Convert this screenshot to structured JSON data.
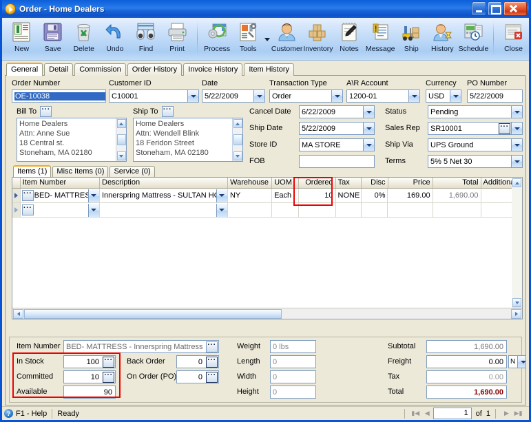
{
  "window": {
    "title": "Order - Home Dealers",
    "icon": "play-circle-icon",
    "buttons": {
      "minimize": "minimize-icon",
      "maximize": "maximize-icon",
      "close": "close-icon"
    }
  },
  "toolbar": {
    "items": [
      {
        "label": "New",
        "icon": "new-document-icon"
      },
      {
        "label": "Save",
        "icon": "floppy-disk-icon"
      },
      {
        "label": "Delete",
        "icon": "trash-can-icon"
      },
      {
        "label": "Undo",
        "icon": "undo-arrow-icon"
      },
      {
        "label": "Find",
        "icon": "binoculars-icon"
      },
      {
        "label": "Print",
        "icon": "printer-icon"
      },
      {
        "label": "Process",
        "icon": "gear-window-icon"
      },
      {
        "label": "Tools",
        "icon": "wrench-screwdriver-icon"
      },
      {
        "label": "Customer",
        "icon": "person-icon"
      },
      {
        "label": "Inventory",
        "icon": "boxes-icon"
      },
      {
        "label": "Notes",
        "icon": "notepad-pen-icon"
      },
      {
        "label": "Message",
        "icon": "message-document-icon"
      },
      {
        "label": "Ship",
        "icon": "forklift-icon"
      },
      {
        "label": "History",
        "icon": "person-hourglass-icon"
      },
      {
        "label": "Schedule",
        "icon": "calendar-clock-icon"
      },
      {
        "label": "Close",
        "icon": "close-window-icon"
      }
    ]
  },
  "tabs": [
    {
      "label": "General",
      "active": true
    },
    {
      "label": "Detail",
      "active": false
    },
    {
      "label": "Commission",
      "active": false
    },
    {
      "label": "Order History",
      "active": false
    },
    {
      "label": "Invoice History",
      "active": false
    },
    {
      "label": "Item History",
      "active": false
    }
  ],
  "header_fields": {
    "order_number": {
      "label": "Order Number",
      "value": "OE-10038",
      "selected": true
    },
    "customer_id": {
      "label": "Customer ID",
      "value": "C10001"
    },
    "date": {
      "label": "Date",
      "value": "5/22/2009"
    },
    "transaction_type": {
      "label": "Transaction Type",
      "value": "Order"
    },
    "ar_account": {
      "label": "A\\R Account",
      "value": "1200-01"
    },
    "currency": {
      "label": "Currency",
      "value": "USD"
    },
    "po_number": {
      "label": "PO Number",
      "value": "5/22/2009"
    }
  },
  "bill_to": {
    "label": "Bill To",
    "lines": [
      "Home Dealers",
      "Attn: Anne Sue",
      "18 Central st.",
      "Stoneham, MA 02180"
    ]
  },
  "ship_to": {
    "label": "Ship To",
    "lines": [
      "Home Dealers",
      "Attn: Wendell Blink",
      "18 Feridon Street",
      "Stoneham, MA 02180"
    ]
  },
  "mid_left_fields": [
    {
      "label": "Cancel  Date",
      "value": "6/22/2009",
      "type": "combo"
    },
    {
      "label": "Ship Date",
      "value": "5/22/2009",
      "type": "combo"
    },
    {
      "label": "Store ID",
      "value": "MA STORE",
      "type": "combo"
    },
    {
      "label": "FOB",
      "value": "",
      "type": "text"
    }
  ],
  "mid_right_fields": [
    {
      "label": "Status",
      "value": "Pending",
      "type": "combo"
    },
    {
      "label": "Sales Rep",
      "value": "SR10001",
      "type": "combo-ellipsis"
    },
    {
      "label": "Ship Via",
      "value": "UPS Ground",
      "type": "combo"
    },
    {
      "label": "Terms",
      "value": "5% 5 Net 30",
      "type": "combo"
    }
  ],
  "item_tabs": [
    {
      "label": "Items (1)",
      "active": true
    },
    {
      "label": "Misc Items (0)",
      "active": false
    },
    {
      "label": "Service (0)",
      "active": false
    }
  ],
  "grid": {
    "columns": [
      "Item Number",
      "Description",
      "Warehouse",
      "UOM",
      "Ordered",
      "Tax",
      "Disc",
      "Price",
      "Total",
      "Additional"
    ],
    "highlight_column": "Ordered",
    "rows": [
      {
        "item_number": "BED- MATTRESS",
        "description": "Innerspring Mattress - SULTAN HO",
        "warehouse": "NY",
        "uom": "Each",
        "ordered": "10",
        "tax": "NONE",
        "disc": "0%",
        "price": "169.00",
        "total": "1,690.00",
        "additional": ""
      },
      {
        "item_number": "",
        "description": "",
        "warehouse": "",
        "uom": "",
        "ordered": "",
        "tax": "",
        "disc": "",
        "price": "",
        "total": "",
        "additional": ""
      }
    ]
  },
  "detail": {
    "item_number": {
      "label": "Item Number",
      "value": "BED- MATTRESS - Innerspring Mattress - S"
    },
    "stock": [
      {
        "label": "In Stock",
        "value": "100",
        "ellipsis": true
      },
      {
        "label": "Committed",
        "value": "10",
        "ellipsis": true
      },
      {
        "label": "Available",
        "value": "90",
        "ellipsis": false
      }
    ],
    "orders": [
      {
        "label": "Back Order",
        "value": "0",
        "ellipsis": true
      },
      {
        "label": "On Order (PO)",
        "value": "0",
        "ellipsis": true
      }
    ],
    "dims": [
      {
        "label": "Weight",
        "value": "0 lbs"
      },
      {
        "label": "Length",
        "value": "0"
      },
      {
        "label": "Width",
        "value": "0"
      },
      {
        "label": "Height",
        "value": "0"
      }
    ],
    "totals": [
      {
        "label": "Subtotal",
        "value": "1,690.00",
        "bold": false
      },
      {
        "label": "Freight",
        "value": "0.00",
        "bold": false,
        "suffix": "N"
      },
      {
        "label": "Tax",
        "value": "0.00",
        "bold": false
      },
      {
        "label": "Total",
        "value": "1,690.00",
        "bold": true
      }
    ]
  },
  "statusbar": {
    "help": "F1 - Help",
    "state": "Ready",
    "page_current": "1",
    "page_of": "of",
    "page_total": "1"
  },
  "colors": {
    "accent_tab": "#f5a623",
    "highlight_box": "#ee0000",
    "total_text": "#8b0000",
    "titlebar": "#1064dd",
    "panel_bg": "#ece9d8"
  }
}
